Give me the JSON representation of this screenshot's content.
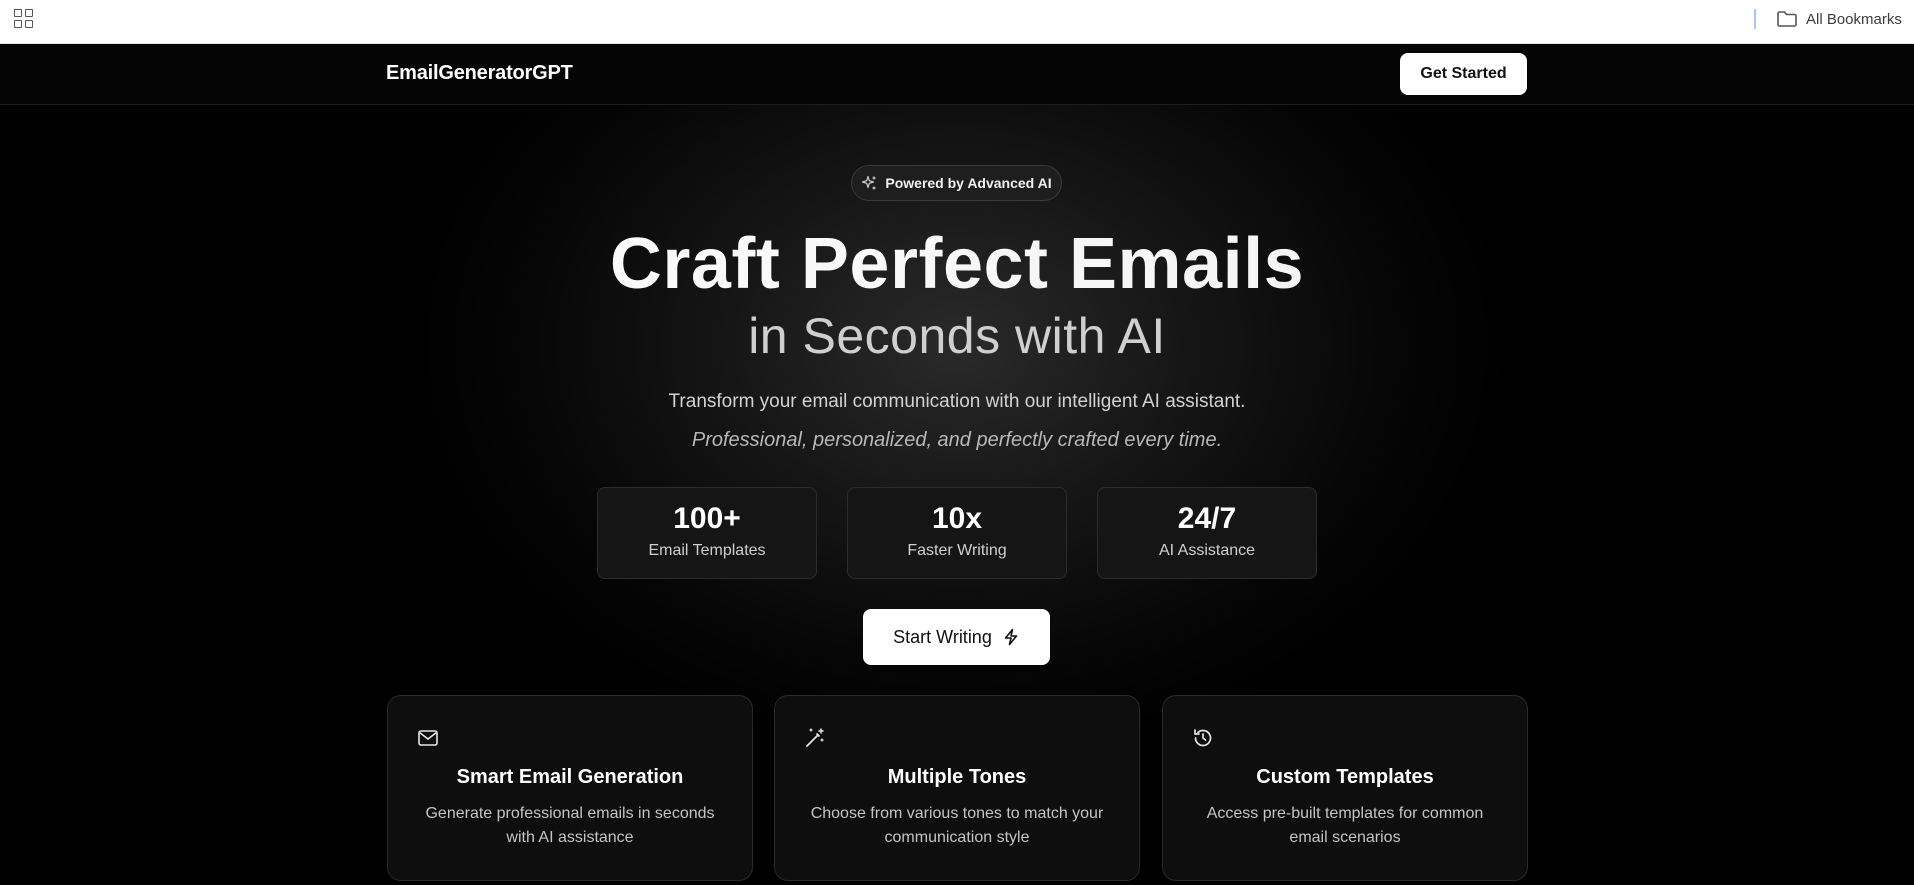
{
  "browser": {
    "bookmarks_label": "All Bookmarks"
  },
  "header": {
    "logo": "EmailGeneratorGPT",
    "cta_label": "Get Started"
  },
  "hero": {
    "badge": "Powered by Advanced AI",
    "title": "Craft Perfect Emails",
    "subtitle": "in Seconds with AI",
    "lead": "Transform your email communication with our intelligent AI assistant.",
    "lead_italic": "Professional, personalized, and perfectly crafted every time.",
    "stats": [
      {
        "value": "100+",
        "label": "Email Templates"
      },
      {
        "value": "10x",
        "label": "Faster Writing"
      },
      {
        "value": "24/7",
        "label": "AI Assistance"
      }
    ],
    "start_label": "Start Writing"
  },
  "features": [
    {
      "icon": "mail-icon",
      "title": "Smart Email Generation",
      "description": "Generate professional emails in seconds with AI assistance"
    },
    {
      "icon": "magic-wand-icon",
      "title": "Multiple Tones",
      "description": "Choose from various tones to match your communication style"
    },
    {
      "icon": "history-icon",
      "title": "Custom Templates",
      "description": "Access pre-built templates for common email scenarios"
    }
  ],
  "colors": {
    "background": "#000000",
    "accent_button": "#ffffff",
    "card_border": "#2a2a2a"
  }
}
